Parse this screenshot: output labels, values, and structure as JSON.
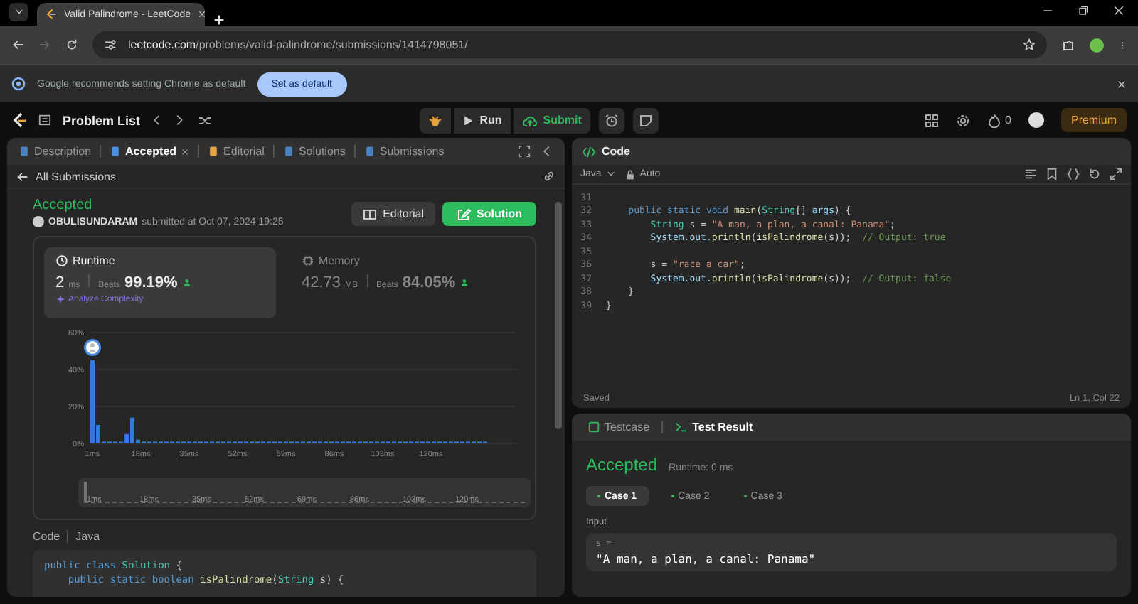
{
  "browser": {
    "tab_title": "Valid Palindrome - LeetCode",
    "url_host": "leetcode.com",
    "url_path": "/problems/valid-palindrome/submissions/1414798051/"
  },
  "infobar": {
    "message": "Google recommends setting Chrome as default",
    "button": "Set as default"
  },
  "header": {
    "problem_list": "Problem List",
    "run": "Run",
    "submit": "Submit",
    "streak": "0",
    "premium": "Premium"
  },
  "left_panel": {
    "tabs": [
      {
        "label": "Description",
        "selected": false,
        "closable": false
      },
      {
        "label": "Accepted",
        "selected": true,
        "closable": true
      },
      {
        "label": "Editorial",
        "selected": false,
        "closable": false
      },
      {
        "label": "Solutions",
        "selected": false,
        "closable": false
      },
      {
        "label": "Submissions",
        "selected": false,
        "closable": false
      }
    ],
    "back_link": "All Submissions",
    "submission": {
      "status": "Accepted",
      "user": "OBULISUNDARAM",
      "submitted": "submitted at Oct 07, 2024 19:25",
      "editorial_button": "Editorial",
      "solution_button": "Solution"
    },
    "metrics": [
      {
        "label": "Runtime",
        "value": "2",
        "unit": "ms",
        "beats_label": "Beats",
        "beats": "99.19%",
        "analyze": "Analyze Complexity",
        "selected": true
      },
      {
        "label": "Memory",
        "value": "42.73",
        "unit": "MB",
        "beats_label": "Beats",
        "beats": "84.05%",
        "selected": false
      }
    ],
    "chart_data": {
      "type": "bar",
      "x": [
        1,
        3,
        5,
        7,
        9,
        11,
        13,
        15,
        17,
        19,
        21,
        23,
        25,
        27,
        29,
        31,
        33,
        35,
        37,
        39,
        41,
        43,
        45,
        47,
        49,
        51,
        53,
        55,
        57,
        59,
        61,
        63,
        65,
        67,
        69,
        71,
        73,
        75,
        77,
        79,
        81,
        83,
        85,
        87,
        89,
        91,
        93,
        95,
        97,
        99,
        101,
        103,
        105,
        107,
        109,
        111,
        113,
        115,
        117,
        119,
        121,
        123,
        125,
        127,
        129,
        131,
        133,
        135,
        137,
        139
      ],
      "values": [
        45,
        10,
        1,
        1,
        1,
        1,
        5,
        14,
        2,
        1,
        1,
        1,
        1,
        1,
        1,
        1,
        1,
        1,
        1,
        1,
        1,
        1,
        1,
        1,
        1,
        1,
        1,
        1,
        1,
        1,
        1,
        1,
        1,
        1,
        1,
        1,
        1,
        1,
        1,
        1,
        1,
        1,
        1,
        1,
        1,
        1,
        1,
        1,
        1,
        1,
        1,
        1,
        1,
        1,
        1,
        1,
        1,
        1,
        1,
        1,
        1,
        1,
        1,
        1,
        1,
        1,
        1,
        1,
        1,
        1
      ],
      "xlim": [
        0,
        150
      ],
      "ylim": [
        0,
        60
      ],
      "yticks": [
        {
          "value": 0,
          "label": "0%"
        },
        {
          "value": 20,
          "label": "20%"
        },
        {
          "value": 40,
          "label": "40%"
        },
        {
          "value": 60,
          "label": "60%"
        }
      ],
      "xticks": [
        {
          "value": 1,
          "label": "1ms"
        },
        {
          "value": 18,
          "label": "18ms"
        },
        {
          "value": 35,
          "label": "35ms"
        },
        {
          "value": 52,
          "label": "52ms"
        },
        {
          "value": 69,
          "label": "69ms"
        },
        {
          "value": 86,
          "label": "86ms"
        },
        {
          "value": 103,
          "label": "103ms"
        },
        {
          "value": 120,
          "label": "120ms"
        }
      ]
    },
    "navigator_labels": [
      "1ms",
      "18ms",
      "35ms",
      "52ms",
      "69ms",
      "86ms",
      "103ms",
      "120ms"
    ],
    "code_heading": {
      "label": "Code",
      "language": "Java"
    },
    "code_lines": [
      {
        "tokens": [
          {
            "text": "public class ",
            "kind": "kw"
          },
          {
            "text": "Solution",
            "kind": "type"
          },
          {
            "text": " {",
            "kind": "plain"
          }
        ]
      },
      {
        "tokens": [
          {
            "text": "    public static boolean ",
            "kind": "kw"
          },
          {
            "text": "isPalindrome",
            "kind": "fn"
          },
          {
            "text": "(",
            "kind": "plain"
          },
          {
            "text": "String",
            "kind": "type"
          },
          {
            "text": " s) {",
            "kind": "plain"
          }
        ]
      }
    ]
  },
  "editor": {
    "title": "Code",
    "language": "Java",
    "mode": "Auto",
    "lines": [
      {
        "number": "31"
      },
      {
        "number": "32",
        "tokens": [
          {
            "text": "    public static void ",
            "kind": "kw"
          },
          {
            "text": "main",
            "kind": "fn"
          },
          {
            "text": "(",
            "kind": "plain"
          },
          {
            "text": "String",
            "kind": "type"
          },
          {
            "text": "[] ",
            "kind": "plain"
          },
          {
            "text": "args",
            "kind": "var"
          },
          {
            "text": ") {",
            "kind": "plain"
          }
        ]
      },
      {
        "number": "33",
        "tokens": [
          {
            "text": "        String",
            "kind": "type"
          },
          {
            "text": " s = ",
            "kind": "plain"
          },
          {
            "text": "\"A man, a plan, a canal: Panama\"",
            "kind": "str"
          },
          {
            "text": ";",
            "kind": "plain"
          }
        ]
      },
      {
        "number": "34",
        "tokens": [
          {
            "text": "        System.out.",
            "kind": "var"
          },
          {
            "text": "println",
            "kind": "fn"
          },
          {
            "text": "(",
            "kind": "plain"
          },
          {
            "text": "isPalindrome",
            "kind": "fn"
          },
          {
            "text": "(s));  ",
            "kind": "plain"
          },
          {
            "text": "// Output: true",
            "kind": "comment"
          }
        ]
      },
      {
        "number": "35"
      },
      {
        "number": "36",
        "tokens": [
          {
            "text": "        s = ",
            "kind": "plain"
          },
          {
            "text": "\"race a car\"",
            "kind": "str"
          },
          {
            "text": ";",
            "kind": "plain"
          }
        ]
      },
      {
        "number": "37",
        "tokens": [
          {
            "text": "        System.out.",
            "kind": "var"
          },
          {
            "text": "println",
            "kind": "fn"
          },
          {
            "text": "(",
            "kind": "plain"
          },
          {
            "text": "isPalindrome",
            "kind": "fn"
          },
          {
            "text": "(s));  ",
            "kind": "plain"
          },
          {
            "text": "// Output: false",
            "kind": "comment"
          }
        ]
      },
      {
        "number": "38",
        "tokens": [
          {
            "text": "    }",
            "kind": "plain"
          }
        ]
      },
      {
        "number": "39",
        "tokens": [
          {
            "text": "}",
            "kind": "plain"
          }
        ]
      }
    ],
    "status": "Saved",
    "cursor": "Ln 1, Col 22"
  },
  "console": {
    "tabs": [
      {
        "label": "Testcase",
        "selected": false
      },
      {
        "label": "Test Result",
        "selected": true
      }
    ],
    "verdict": "Accepted",
    "runtime": "Runtime: 0 ms",
    "cases": [
      {
        "label": "Case 1",
        "selected": true
      },
      {
        "label": "Case 2",
        "selected": false
      },
      {
        "label": "Case 3",
        "selected": false
      }
    ],
    "input_label": "Input",
    "variable": "s =",
    "value": "\"A man, a plan, a canal: Panama\""
  }
}
